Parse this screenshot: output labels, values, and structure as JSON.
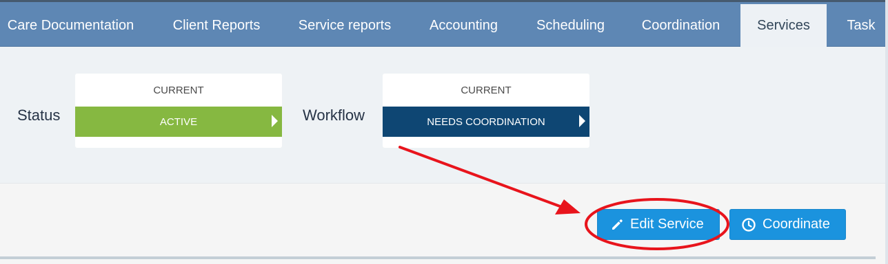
{
  "nav": {
    "tabs": [
      {
        "label": "Care Documentation",
        "active": false
      },
      {
        "label": "Client Reports",
        "active": false
      },
      {
        "label": "Service reports",
        "active": false
      },
      {
        "label": "Accounting",
        "active": false
      },
      {
        "label": "Scheduling",
        "active": false
      },
      {
        "label": "Coordination",
        "active": false
      },
      {
        "label": "Services",
        "active": true
      },
      {
        "label": "Task",
        "active": false
      }
    ]
  },
  "status": {
    "label": "Status",
    "caption": "CURRENT",
    "value": "ACTIVE",
    "color": "#86b841"
  },
  "workflow": {
    "label": "Workflow",
    "caption": "CURRENT",
    "value": "NEEDS COORDINATION",
    "color": "#0e4673"
  },
  "actions": {
    "edit_label": "Edit Service",
    "edit_icon": "pencil-icon",
    "coordinate_label": "Coordinate",
    "coordinate_icon": "clock-icon",
    "button_color": "#1b93de"
  },
  "annotation": {
    "arrow_color": "#e8141c",
    "highlight_target": "edit-service-button"
  }
}
